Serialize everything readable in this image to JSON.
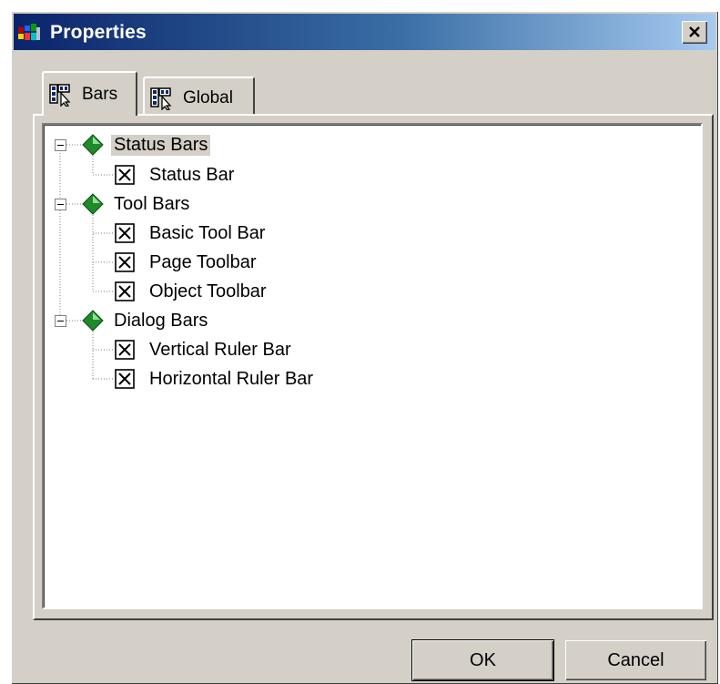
{
  "window": {
    "title": "Properties",
    "icon": "app-icon",
    "close_icon": "close-icon"
  },
  "tabs": [
    {
      "label": "Bars",
      "icon": "toolbar-pointer-icon",
      "active": true
    },
    {
      "label": "Global",
      "icon": "toolbar-pointer-icon",
      "active": false
    }
  ],
  "tree": {
    "groups": [
      {
        "label": "Status Bars",
        "icon": "green-diamond-icon",
        "expanded": true,
        "selected": true,
        "items": [
          {
            "label": "Status Bar",
            "checked": true
          }
        ]
      },
      {
        "label": "Tool Bars",
        "icon": "green-diamond-icon",
        "expanded": true,
        "items": [
          {
            "label": "Basic Tool Bar",
            "checked": true
          },
          {
            "label": "Page Toolbar",
            "checked": true
          },
          {
            "label": "Object Toolbar",
            "checked": true
          }
        ]
      },
      {
        "label": "Dialog Bars",
        "icon": "green-diamond-icon",
        "expanded": true,
        "items": [
          {
            "label": "Vertical Ruler Bar",
            "checked": true
          },
          {
            "label": "Horizontal Ruler Bar",
            "checked": true
          }
        ]
      }
    ]
  },
  "buttons": {
    "ok": "OK",
    "cancel": "Cancel"
  },
  "colors": {
    "titlebar_start": "#0a246a",
    "titlebar_end": "#a6caf0",
    "face": "#d4d0c8",
    "gem": "#1f8a2a"
  }
}
